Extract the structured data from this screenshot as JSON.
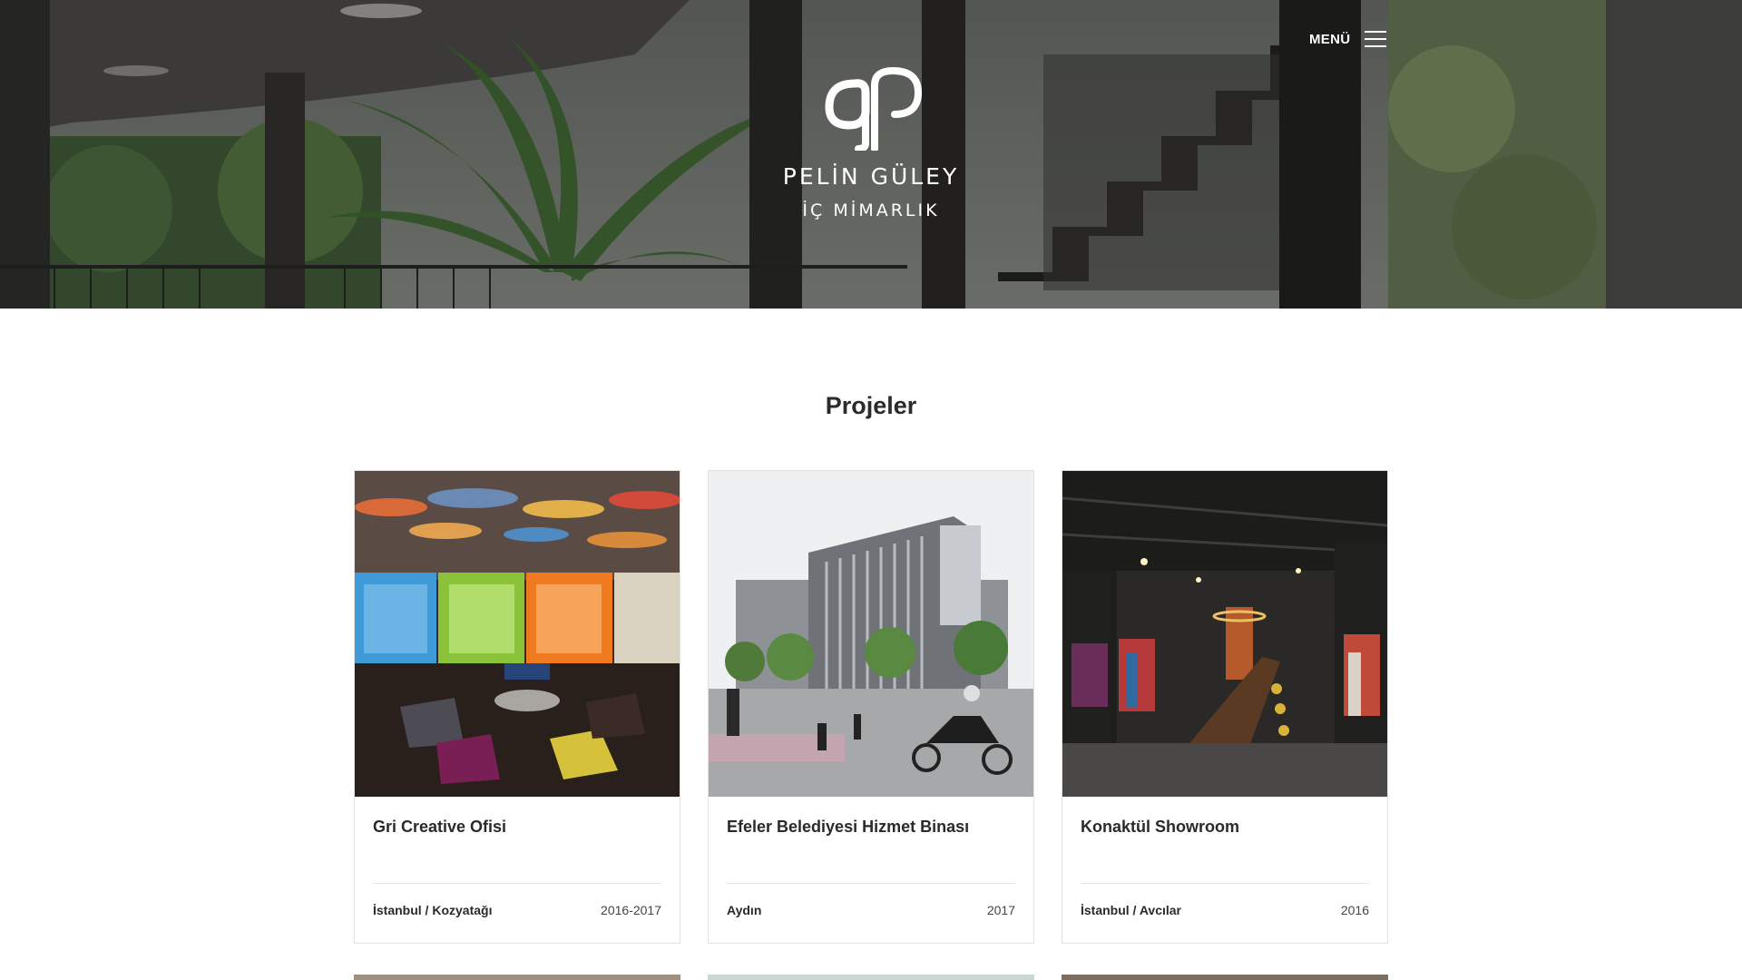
{
  "header": {
    "menu_label": "MENÜ",
    "brand_name": "PELİN GÜLEY",
    "brand_subtitle": "İÇ MİMARLIK",
    "logo_icon": "pg-monogram-icon",
    "menu_icon": "hamburger-icon"
  },
  "main": {
    "section_title": "Projeler",
    "projects": [
      {
        "title": "Gri Creative Ofisi",
        "location": "İstanbul / Kozyatağı",
        "year": "2016-2017"
      },
      {
        "title": "Efeler Belediyesi Hizmet Binası",
        "location": "Aydın",
        "year": "2017"
      },
      {
        "title": "Konaktül Showroom",
        "location": "İstanbul / Avcılar",
        "year": "2016"
      }
    ]
  },
  "colors": {
    "text_dark": "#2a2a2a",
    "card_border": "#e2e2e2",
    "hero_text": "#ffffff"
  }
}
